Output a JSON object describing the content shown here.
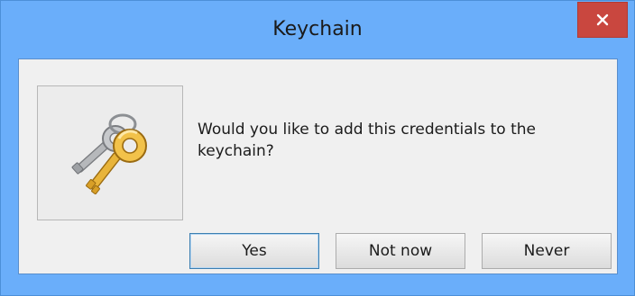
{
  "window": {
    "title": "Keychain",
    "close_icon": "close-icon"
  },
  "dialog": {
    "icon": "keys-icon",
    "message": "Would you like to add this credentials to the keychain?"
  },
  "buttons": {
    "yes": "Yes",
    "not_now": "Not now",
    "never": "Never"
  },
  "colors": {
    "titlebar": "#6aaefa",
    "close_button": "#c9473f",
    "content_bg": "#f0f0f0",
    "default_button_border": "#3c7fb1"
  }
}
